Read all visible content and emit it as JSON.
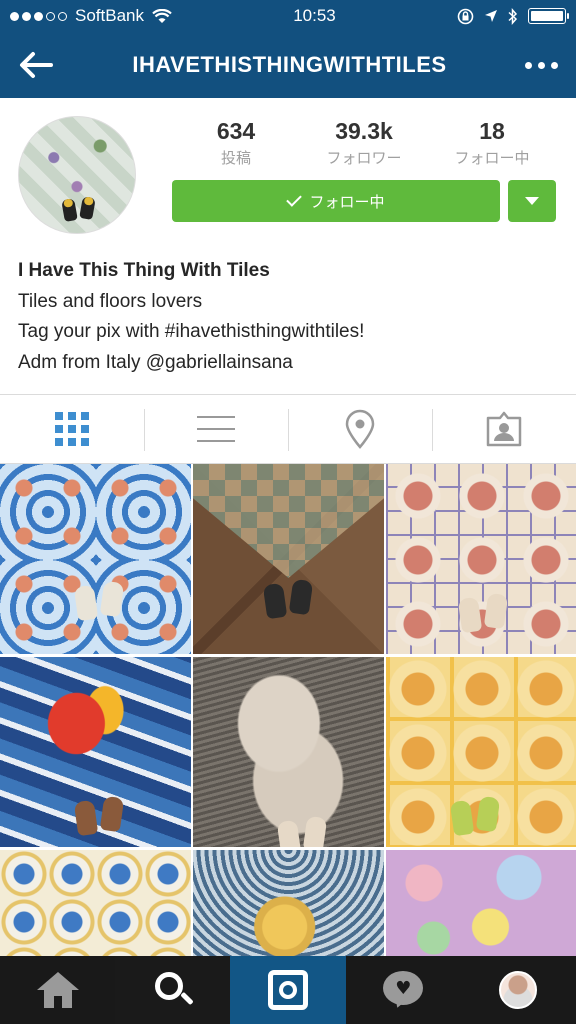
{
  "status_bar": {
    "carrier": "SoftBank",
    "time": "10:53",
    "signal_dots_filled": 3,
    "signal_dots_total": 5
  },
  "nav": {
    "back_icon": "back-arrow-icon",
    "title": "IHAVETHISTHINGWITHTILES",
    "more_icon": "more-dots-icon"
  },
  "profile": {
    "stats": [
      {
        "value": "634",
        "label": "投稿"
      },
      {
        "value": "39.3k",
        "label": "フォロワー"
      },
      {
        "value": "18",
        "label": "フォロー中"
      }
    ],
    "follow_button_label": "フォロー中",
    "bio": {
      "name": "I Have This Thing With Tiles",
      "lines": [
        "Tiles and floors lovers",
        "Tag your pix with #ihavethisthingwithtiles!",
        "Adm from Italy @gabriellainsana"
      ]
    }
  },
  "view_tabs": [
    {
      "icon": "grid-view-icon",
      "selected": true
    },
    {
      "icon": "list-view-icon",
      "selected": false
    },
    {
      "icon": "location-pin-icon",
      "selected": false
    },
    {
      "icon": "tagged-photos-icon",
      "selected": false
    }
  ],
  "tab_bar": [
    {
      "icon": "home-icon"
    },
    {
      "icon": "search-icon",
      "selected": true
    },
    {
      "icon": "camera-icon"
    },
    {
      "icon": "activity-heart-icon"
    },
    {
      "icon": "profile-avatar-icon"
    }
  ],
  "colors": {
    "header_blue": "#12507f",
    "follow_green": "#5fba3c",
    "selected_tab_blue": "#3e8ed0",
    "tab_bar_bg": "#191919"
  }
}
